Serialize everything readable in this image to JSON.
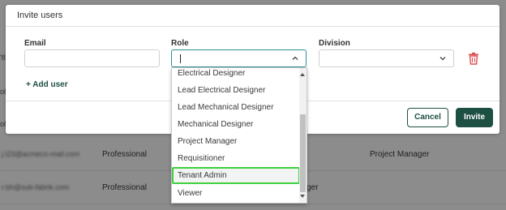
{
  "modal": {
    "title": "Invite users",
    "labels": {
      "email": "Email",
      "role": "Role",
      "division": "Division"
    },
    "email_value": "",
    "role_value": "",
    "division_value": "",
    "add_user": "+ Add user",
    "cancel": "Cancel",
    "invite": "Invite"
  },
  "role_options": [
    "Electrical Designer",
    "Lead Electrical Designer",
    "Lead Mechanical Designer",
    "Mechanical Designer",
    "Project Manager",
    "Requisitioner",
    "Tenant Admin",
    "Viewer"
  ],
  "highlighted_option": "Tenant Admin",
  "background_rows": [
    {
      "email": "j.l23@acmeco-mail.com",
      "type": "Professional",
      "role": "Project Manager"
    },
    {
      "email": "r.bh@sub-fabrik.com",
      "type": "Professional",
      "role_fragment": "ger"
    }
  ],
  "colors": {
    "accent": "#1e4f43",
    "focus_border": "#2f8f92",
    "highlight_outline": "#40d040",
    "delete": "#d9534f"
  },
  "icons": {
    "trash": "trash-icon",
    "chevron": "chevron-down-icon"
  }
}
